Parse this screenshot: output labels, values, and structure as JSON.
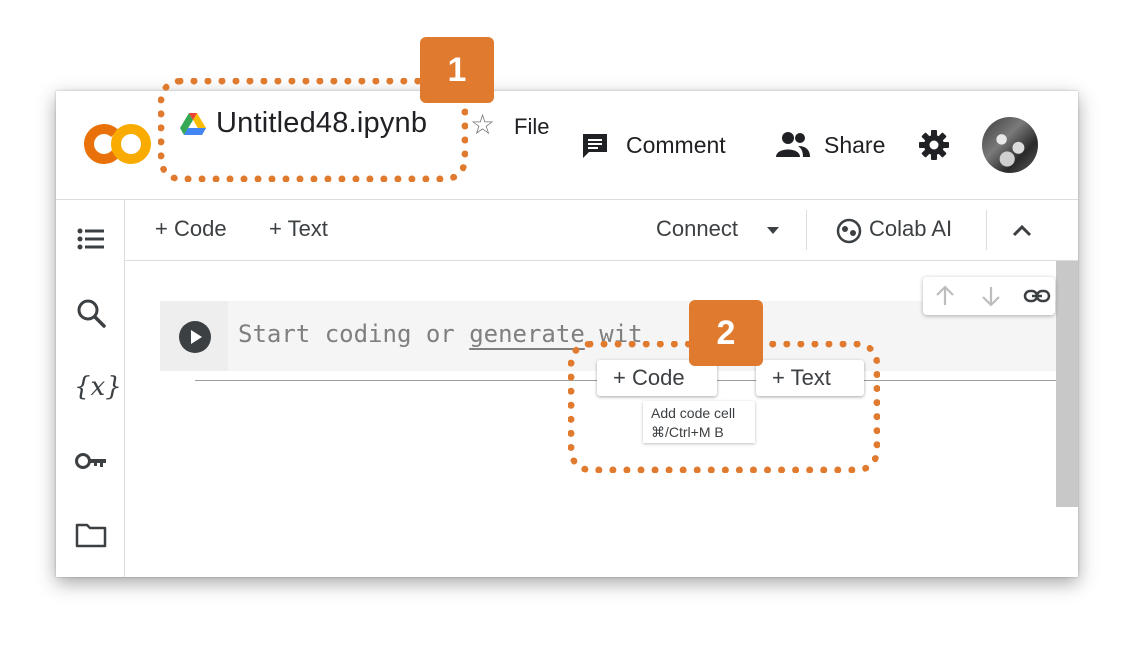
{
  "header": {
    "notebook_title": "Untitled48.ipynb",
    "menu_file": "File",
    "comment_label": "Comment",
    "share_label": "Share"
  },
  "toolbar": {
    "add_code": "+ Code",
    "add_text": "+ Text",
    "connect": "Connect",
    "colab_ai": "Colab AI"
  },
  "cell": {
    "placeholder_before": "Start coding or ",
    "placeholder_link": "generate",
    "placeholder_after": " wit"
  },
  "insert_buttons": {
    "code": "+ Code",
    "text": "+ Text"
  },
  "tooltip": {
    "line1": "Add code cell",
    "line2": "⌘/Ctrl+M B"
  },
  "annotations": {
    "badge_1": "1",
    "badge_2": "2"
  },
  "colors": {
    "annotation": "#e07a2e",
    "logo_dark": "#e8710a",
    "logo_light": "#f9ab00"
  },
  "icons": [
    "colab-logo-icon",
    "drive-icon",
    "star-icon",
    "comment-icon",
    "share-people-icon",
    "gear-icon",
    "table-of-contents-icon",
    "search-icon",
    "variables-icon",
    "key-icon",
    "folder-icon",
    "run-icon",
    "chevron-down-icon",
    "colab-ai-icon",
    "chevron-up-icon",
    "arrow-up-icon",
    "arrow-down-icon",
    "link-icon"
  ]
}
